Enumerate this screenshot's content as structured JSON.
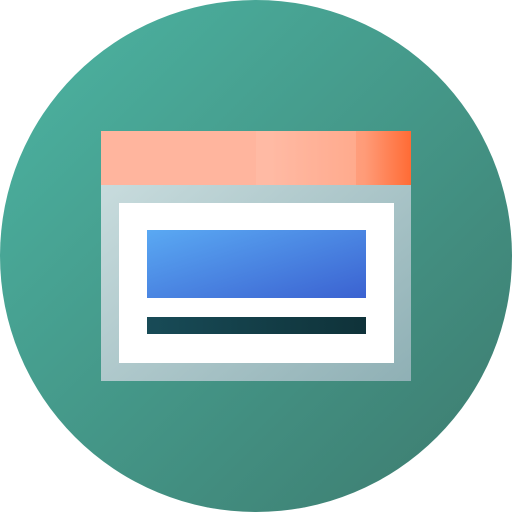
{
  "icon": {
    "name": "browser-window-icon",
    "colors": {
      "circle_light": "#4cb5a3",
      "circle_dark": "#3d7a6e",
      "titlebar_light": "#ffb59e",
      "titlebar_dark": "#ff6b35",
      "frame_light": "#cfe1e2",
      "frame_dark": "#8fb0b5",
      "content": "#ffffff",
      "banner_light": "#5aa9f3",
      "banner_dark": "#3b62d1",
      "text_line_light": "#184b57",
      "text_line_dark": "#0f3239"
    }
  }
}
